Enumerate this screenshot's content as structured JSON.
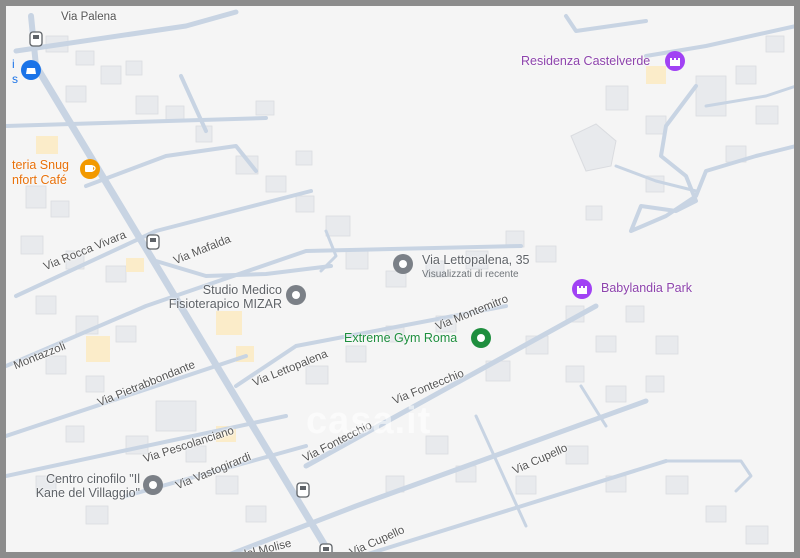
{
  "map": {
    "streets": [
      {
        "id": "via-palena",
        "label": "Via Palena"
      },
      {
        "id": "via-rocca-vivara",
        "label": "Via Rocca Vivara"
      },
      {
        "id": "via-mafalda",
        "label": "Via Mafalda"
      },
      {
        "id": "via-montazzoli",
        "label": "Montazzoli"
      },
      {
        "id": "via-pietrabbondante",
        "label": "Via Pietrabbondante"
      },
      {
        "id": "via-lettopalena",
        "label": "Via Lettopalena"
      },
      {
        "id": "via-montemitro",
        "label": "Via Montemitro"
      },
      {
        "id": "via-fontecchio-1",
        "label": "Via Fontecchio"
      },
      {
        "id": "via-fontecchio-2",
        "label": "Via Fontecchio"
      },
      {
        "id": "via-pescolanciano",
        "label": "Via Pescolanciano"
      },
      {
        "id": "via-vastogirardi",
        "label": "Via Vastogirardi"
      },
      {
        "id": "via-cupello-1",
        "label": "Via Cupello"
      },
      {
        "id": "via-cupello-2",
        "label": "Via Cupello"
      },
      {
        "id": "via-molise",
        "label": "no del Molise"
      }
    ],
    "pois": {
      "residenza": {
        "name": "Residenza Castelverde",
        "icon": "castle-icon",
        "color": "#a142f4"
      },
      "cafeteria": {
        "line1": "teria Snug",
        "line2": "nfort Café",
        "icon": "coffee-icon",
        "color": "#f29900"
      },
      "left_edge": {
        "line1": "i",
        "line2": "s",
        "icon": "drive-icon",
        "color": "#1a73e8"
      },
      "lettopalena": {
        "name": "Via Lettopalena, 35",
        "sub": "Visualizzati di recente",
        "icon": "pin-icon",
        "color": "#7b8087"
      },
      "studio": {
        "line1": "Studio Medico",
        "line2": "Fisioterapico MIZAR",
        "icon": "pin-icon",
        "color": "#7b8087"
      },
      "babylandia": {
        "name": "Babylandia Park",
        "icon": "castle-icon",
        "color": "#a142f4"
      },
      "gym": {
        "name": "Extreme Gym Roma",
        "icon": "gym-icon",
        "color": "#1e8e3e"
      },
      "cinofilo": {
        "line1": "Centro cinofilo \"Il",
        "line2": "Kane del Villaggio\"",
        "icon": "pin-icon",
        "color": "#7b8087"
      }
    },
    "watermark": "casa.it"
  }
}
